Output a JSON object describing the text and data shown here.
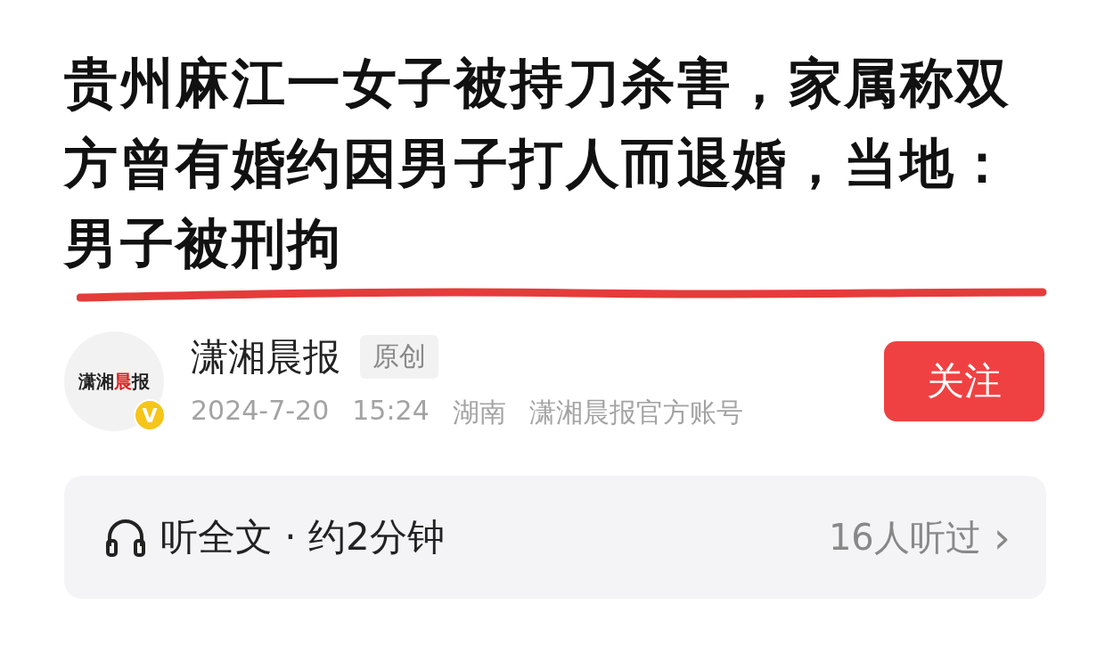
{
  "headline": "贵州麻江一女子被持刀杀害，家属称双方曾有婚约因男子打人而退婚，当地：男子被刑拘",
  "author": {
    "logo": [
      {
        "text": "潇湘",
        "red": false
      },
      {
        "text": "晨",
        "red": true
      },
      {
        "text": "报",
        "red": false
      }
    ],
    "verified_badge": "V",
    "name": "潇湘晨报",
    "tag": "原创",
    "meta": [
      "2024-7-20",
      "15:24",
      "湖南",
      "潇湘晨报官方账号"
    ],
    "follow_button": "关注"
  },
  "audio": {
    "label": "听全文 · 约2分钟",
    "listeners": "16人听过",
    "chevron": "›"
  }
}
